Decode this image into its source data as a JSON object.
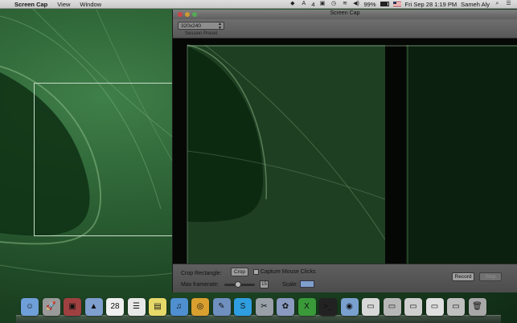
{
  "menubar": {
    "apple_glyph": "",
    "app_name": "Screen Cap",
    "menus": [
      "View",
      "Window"
    ],
    "status": {
      "adium_badge": "4",
      "battery_percent": "99%",
      "battery_level": 0.99,
      "datetime": "Fri Sep 28  1:19 PM",
      "user": "Sameh Aly"
    }
  },
  "window": {
    "title": "Screen Cap",
    "toolbar": {
      "preset_value": "320x240",
      "preset_label": "Session Preset"
    },
    "controls": {
      "crop_label": "Crop Rectangle:",
      "crop_button": "Crop",
      "capture_label": "Capture Mouse Clicks",
      "capture_checked": false,
      "framerate_label": "Max framerate:",
      "framerate_value": "15",
      "framerate_fraction": 0.45,
      "scale_label": "Scale:",
      "record_button": "Record",
      "stop_button": "Stop"
    }
  },
  "dock": {
    "items": [
      {
        "name": "finder-icon",
        "glyph": "☺",
        "color": "#6f9fd8"
      },
      {
        "name": "launchpad-icon",
        "glyph": "🚀",
        "color": "#9a9a9a"
      },
      {
        "name": "photo-booth-icon",
        "glyph": "▣",
        "color": "#a04040"
      },
      {
        "name": "preview-icon",
        "glyph": "▲",
        "color": "#7f9fcf"
      },
      {
        "name": "calendar-icon",
        "glyph": "28",
        "color": "#f0f0f0"
      },
      {
        "name": "reminders-icon",
        "glyph": "☰",
        "color": "#e8e8e8"
      },
      {
        "name": "stickies-icon",
        "glyph": "▤",
        "color": "#e6d96a"
      },
      {
        "name": "itunes-icon",
        "glyph": "♫",
        "color": "#4f8fd0"
      },
      {
        "name": "chrome-icon",
        "glyph": "◎",
        "color": "#d9a030"
      },
      {
        "name": "xcode-icon",
        "glyph": "✎",
        "color": "#6f8fbf"
      },
      {
        "name": "skype-icon",
        "glyph": "S",
        "color": "#2f9ee0"
      },
      {
        "name": "instruments-icon",
        "glyph": "✂",
        "color": "#9aa0a8"
      },
      {
        "name": "iphoto-icon",
        "glyph": "✿",
        "color": "#8a9ac0"
      },
      {
        "name": "excel-icon",
        "glyph": "X",
        "color": "#3a9a3a"
      },
      {
        "name": "terminal-icon",
        "glyph": ">_",
        "color": "#222222"
      },
      {
        "name": "screen-cap-icon",
        "glyph": "◉",
        "color": "#7aa0cf"
      },
      {
        "name": "document-icon",
        "glyph": "▭",
        "color": "#d8d8d8"
      },
      {
        "name": "folder-stack-icon",
        "glyph": "▭",
        "color": "#b8b8b8"
      },
      {
        "name": "download-stack-icon",
        "glyph": "▭",
        "color": "#cfcfcf"
      },
      {
        "name": "window-stack-icon",
        "glyph": "▭",
        "color": "#e0e0e0"
      },
      {
        "name": "screenshot-stack-icon",
        "glyph": "▭",
        "color": "#c0c0c0"
      },
      {
        "name": "trash-icon",
        "glyph": "🗑",
        "color": "#a8a8a8"
      }
    ]
  },
  "colors": {
    "accent": "#7fa0cc",
    "crop_outline": "#c8dcc8"
  }
}
